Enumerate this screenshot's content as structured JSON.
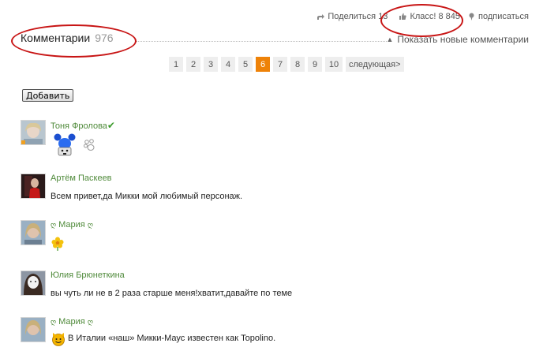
{
  "topbar": {
    "share_label": "Поделиться",
    "share_count": "13",
    "klass_label": "Класс!",
    "klass_count": "8 845",
    "subscribe_label": "подписаться"
  },
  "header": {
    "title": "Комментарии",
    "count": "976",
    "show_new": "Показать новые комментарии"
  },
  "pagination": {
    "pages": [
      "1",
      "2",
      "3",
      "4",
      "5",
      "6",
      "7",
      "8",
      "9",
      "10"
    ],
    "active": "6",
    "next": "следующая>"
  },
  "add_button": "Добавить",
  "comments": [
    {
      "author": "Тоня Фролова",
      "verified_mark": "✔",
      "text": ""
    },
    {
      "author": "Артём Паскеев",
      "text": "Всем привет,да Микки мой любимый персонаж."
    },
    {
      "author_prefix": "ღ",
      "author": "Мария",
      "author_suffix": "ღ",
      "text": ""
    },
    {
      "author": "Юлия Брюнеткина",
      "text": "вы чуть ли не в 2 раза старше меня!хватит,давайте по теме"
    },
    {
      "author_prefix": "ღ",
      "author": "Мария",
      "author_suffix": "ღ",
      "text": "В Италии «наш» Микки-Маус известен как Topolino."
    }
  ],
  "colors": {
    "accent_orange": "#ee8208",
    "author_green": "#4f8a3a",
    "annotation_red": "#c81515"
  }
}
